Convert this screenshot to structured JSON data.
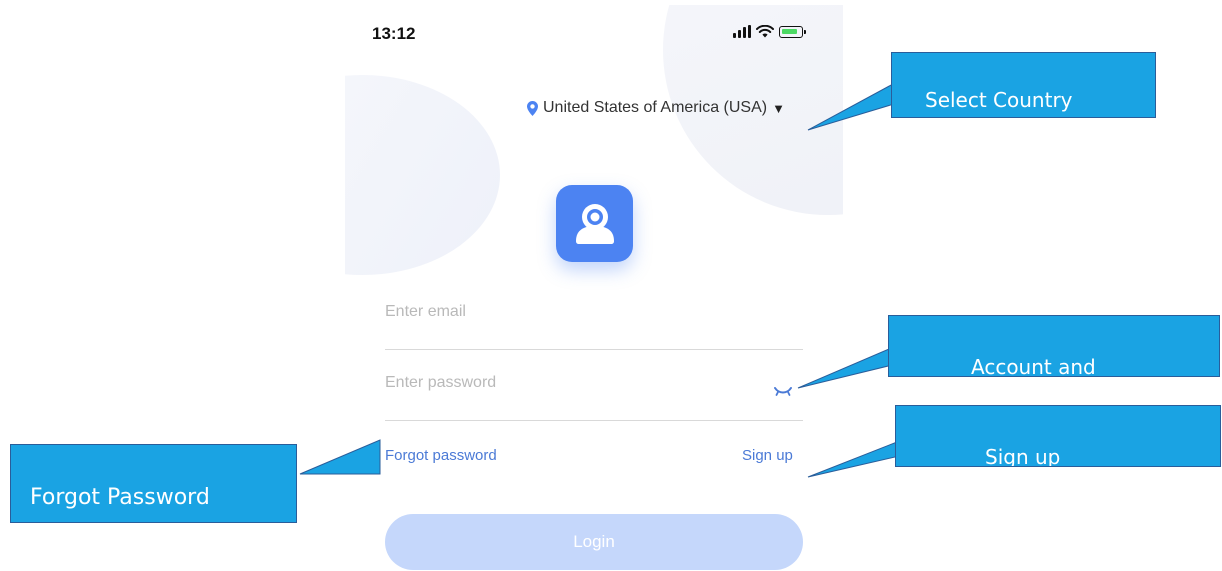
{
  "status_bar": {
    "time": "13:12"
  },
  "country_selector": {
    "label": "United States of America (USA)",
    "caret": "▼"
  },
  "login_form": {
    "email_placeholder": "Enter email",
    "password_placeholder": "Enter password",
    "forgot_password": "Forgot password",
    "sign_up": "Sign up",
    "login_button": "Login"
  },
  "annotations": {
    "select_country": "Select Country",
    "account_and": "Account and",
    "sign_up": "Sign up",
    "forgot_password": "Forgot Password"
  },
  "colors": {
    "accent": "#4c83f2",
    "link": "#4b7ad6",
    "login_disabled": "#c5d7fb",
    "callout": "#1aa3e3"
  },
  "icons": [
    "location-pin-icon",
    "signal-icon",
    "wifi-icon",
    "battery-charging-icon",
    "camera-user-logo",
    "eye-closed-icon"
  ]
}
